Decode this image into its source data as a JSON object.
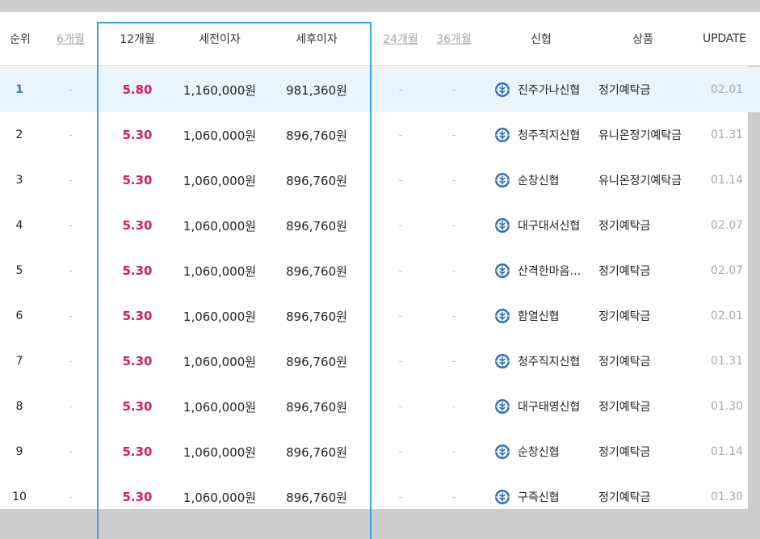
{
  "header": {
    "rank": "순위",
    "m6": "6개월",
    "m12": "12개월",
    "pretax": "세전이자",
    "aftertax": "세후이자",
    "m24": "24개월",
    "m36": "36개월",
    "bank": "신협",
    "product": "상품",
    "update": "UPDATE"
  },
  "colors": {
    "accent_border": "#39a0e3",
    "rate_red": "#d21f57",
    "highlight_row": "#eaf4fd",
    "logo_blue": "#2f6fb5"
  },
  "rows": [
    {
      "rank": "1",
      "m6": "-",
      "m12": "5.80",
      "pretax": "1,160,000원",
      "aftertax": "981,360원",
      "m24": "-",
      "m36": "-",
      "bank": "진주가나신협",
      "product": "정기예탁금",
      "update": "02.01",
      "logo_icon": "shinhyup-logo-icon"
    },
    {
      "rank": "2",
      "m6": "-",
      "m12": "5.30",
      "pretax": "1,060,000원",
      "aftertax": "896,760원",
      "m24": "-",
      "m36": "-",
      "bank": "청주직지신협",
      "product": "유니온정기예탁금",
      "update": "01.31",
      "logo_icon": "shinhyup-logo-icon"
    },
    {
      "rank": "3",
      "m6": "-",
      "m12": "5.30",
      "pretax": "1,060,000원",
      "aftertax": "896,760원",
      "m24": "-",
      "m36": "-",
      "bank": "순창신협",
      "product": "유니온정기예탁금",
      "update": "01.14",
      "logo_icon": "shinhyup-logo-icon"
    },
    {
      "rank": "4",
      "m6": "-",
      "m12": "5.30",
      "pretax": "1,060,000원",
      "aftertax": "896,760원",
      "m24": "-",
      "m36": "-",
      "bank": "대구대서신협",
      "product": "정기예탁금",
      "update": "02.07",
      "logo_icon": "shinhyup-logo-icon"
    },
    {
      "rank": "5",
      "m6": "-",
      "m12": "5.30",
      "pretax": "1,060,000원",
      "aftertax": "896,760원",
      "m24": "-",
      "m36": "-",
      "bank": "산격한마음…",
      "product": "정기예탁금",
      "update": "02.07",
      "logo_icon": "shinhyup-logo-icon"
    },
    {
      "rank": "6",
      "m6": "-",
      "m12": "5.30",
      "pretax": "1,060,000원",
      "aftertax": "896,760원",
      "m24": "-",
      "m36": "-",
      "bank": "함열신협",
      "product": "정기예탁금",
      "update": "02.01",
      "logo_icon": "shinhyup-logo-icon"
    },
    {
      "rank": "7",
      "m6": "-",
      "m12": "5.30",
      "pretax": "1,060,000원",
      "aftertax": "896,760원",
      "m24": "-",
      "m36": "-",
      "bank": "청주직지신협",
      "product": "정기예탁금",
      "update": "01.31",
      "logo_icon": "shinhyup-logo-icon"
    },
    {
      "rank": "8",
      "m6": "-",
      "m12": "5.30",
      "pretax": "1,060,000원",
      "aftertax": "896,760원",
      "m24": "-",
      "m36": "-",
      "bank": "대구태영신협",
      "product": "정기예탁금",
      "update": "01.30",
      "logo_icon": "shinhyup-logo-icon"
    },
    {
      "rank": "9",
      "m6": "-",
      "m12": "5.30",
      "pretax": "1,060,000원",
      "aftertax": "896,760원",
      "m24": "-",
      "m36": "-",
      "bank": "순창신협",
      "product": "정기예탁금",
      "update": "01.14",
      "logo_icon": "shinhyup-logo-icon"
    },
    {
      "rank": "10",
      "m6": "-",
      "m12": "5.30",
      "pretax": "1,060,000원",
      "aftertax": "896,760원",
      "m24": "-",
      "m36": "-",
      "bank": "구즉신협",
      "product": "정기예탁금",
      "update": "01.30",
      "logo_icon": "shinhyup-logo-icon"
    }
  ]
}
